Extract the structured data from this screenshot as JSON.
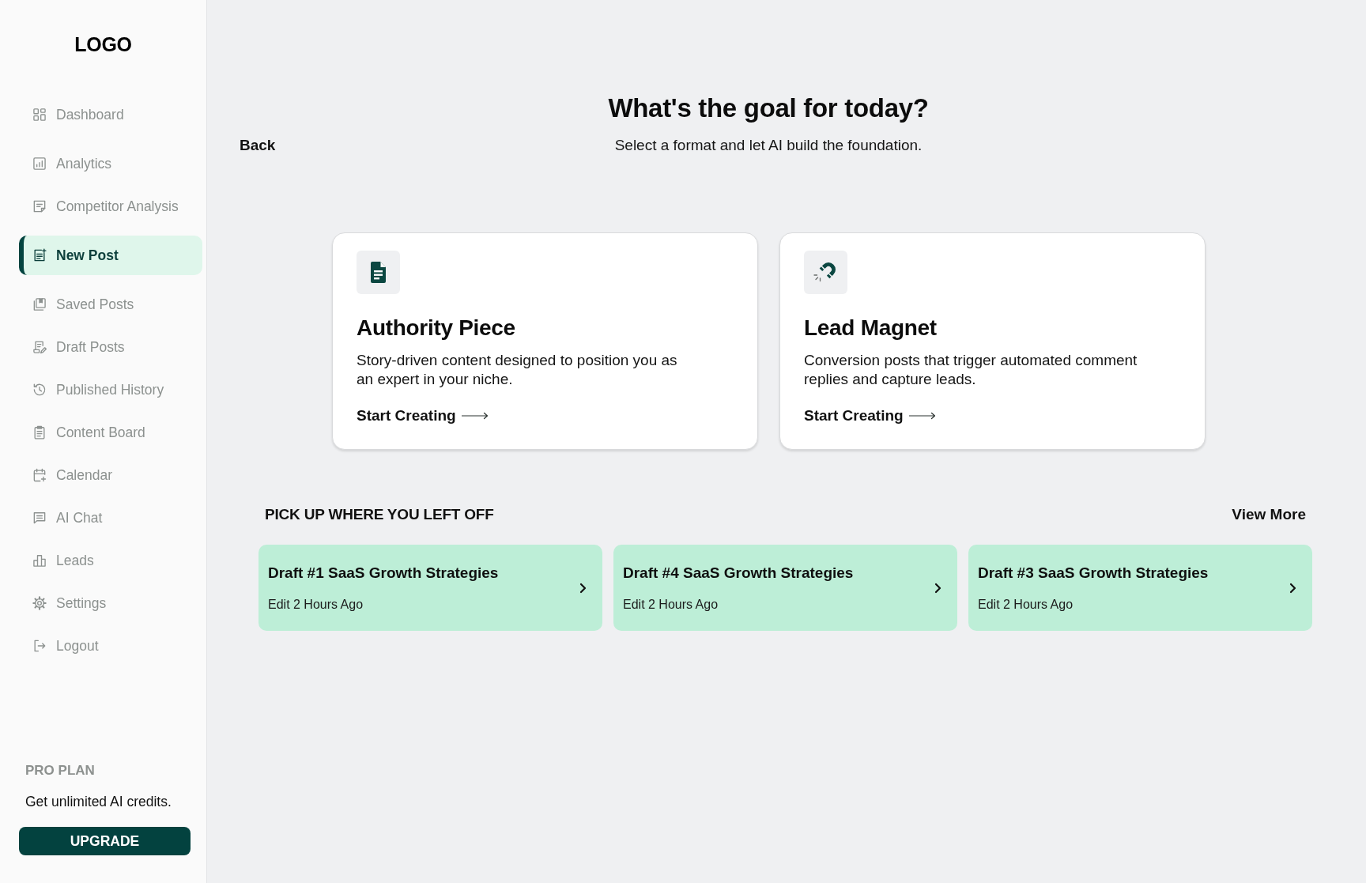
{
  "sidebar": {
    "logo": "LOGO",
    "items": [
      {
        "label": "Dashboard",
        "selected": false
      },
      {
        "label": "Analytics",
        "selected": false
      },
      {
        "label": "Competitor Analysis",
        "selected": false
      },
      {
        "label": "New Post",
        "selected": true
      },
      {
        "label": "Saved Posts",
        "selected": false
      },
      {
        "label": "Draft Posts",
        "selected": false
      },
      {
        "label": "Published History",
        "selected": false
      },
      {
        "label": "Content Board",
        "selected": false
      },
      {
        "label": "Calendar",
        "selected": false
      },
      {
        "label": "AI Chat",
        "selected": false
      },
      {
        "label": "Leads",
        "selected": false
      },
      {
        "label": "Settings",
        "selected": false
      },
      {
        "label": "Logout",
        "selected": false
      }
    ],
    "plan": {
      "title": "PRO PLAN",
      "text": "Get unlimited AI credits.",
      "button": "UPGRADE"
    }
  },
  "header": {
    "back": "Back",
    "title": "What's the goal for today?",
    "subtitle": "Select a format and let AI build the foundation."
  },
  "formats": [
    {
      "title": "Authority Piece",
      "description": "Story-driven content designed to position you as an expert in your niche.",
      "action": "Start Creating"
    },
    {
      "title": "Lead Magnet",
      "description": "Conversion posts that trigger automated comment replies and capture leads.",
      "action": "Start Creating"
    }
  ],
  "recent": {
    "heading": "PICK UP WHERE YOU LEFT OFF",
    "view_more": "View More",
    "drafts": [
      {
        "title": "Draft #1 SaaS Growth Strategies",
        "edited": "Edit 2 Hours Ago"
      },
      {
        "title": "Draft #4 SaaS Growth Strategies",
        "edited": "Edit 2 Hours Ago"
      },
      {
        "title": "Draft #3 SaaS Growth Strategies",
        "edited": "Edit 2 Hours Ago"
      }
    ]
  }
}
